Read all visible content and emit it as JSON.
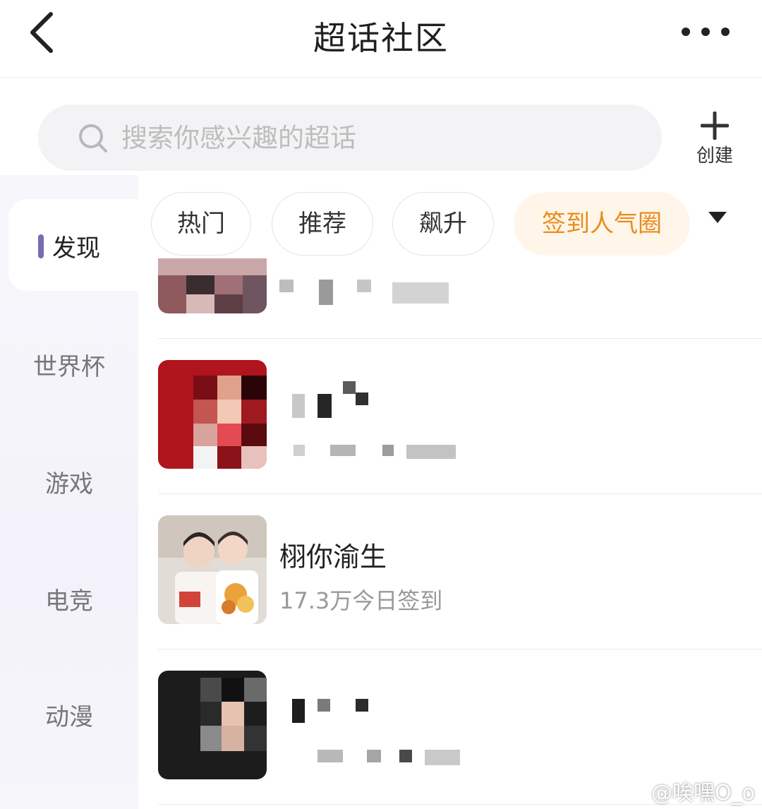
{
  "header": {
    "title": "超话社区"
  },
  "search": {
    "placeholder": "搜索你感兴趣的超话"
  },
  "create": {
    "label": "创建"
  },
  "sidebar": {
    "items": [
      {
        "label": "发现",
        "active": true
      },
      {
        "label": "世界杯",
        "active": false
      },
      {
        "label": "游戏",
        "active": false
      },
      {
        "label": "电竞",
        "active": false
      },
      {
        "label": "动漫",
        "active": false
      }
    ]
  },
  "chips": [
    {
      "label": "热门",
      "active": false
    },
    {
      "label": "推荐",
      "active": false
    },
    {
      "label": "飙升",
      "active": false
    },
    {
      "label": "签到人气圈",
      "active": true
    }
  ],
  "list": {
    "items": [
      {
        "name": "",
        "sub": "",
        "redacted": true
      },
      {
        "name": "",
        "sub": "",
        "redacted": true
      },
      {
        "name": "栩你渝生",
        "sub": "17.3万今日签到",
        "redacted": false
      },
      {
        "name": "",
        "sub": "",
        "redacted": true
      }
    ]
  },
  "colors": {
    "accent": "#e98c1c",
    "accent_bg": "#fff6e9",
    "active_indicator": "#7a6bb3"
  },
  "watermark": "@唉嘿O_o"
}
